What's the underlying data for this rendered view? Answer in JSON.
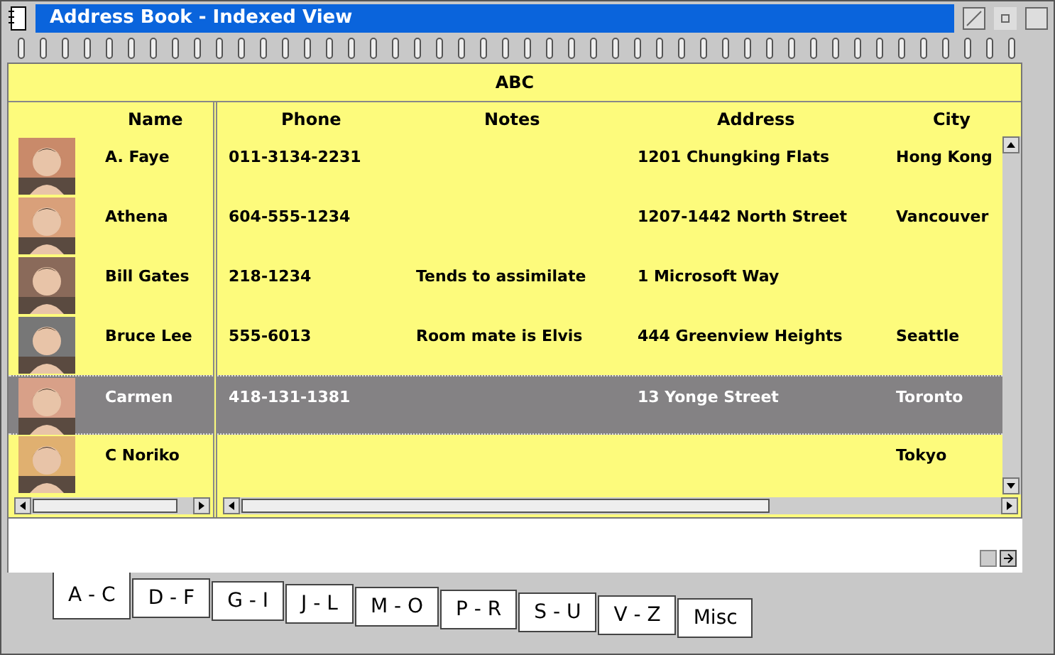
{
  "window": {
    "title": "Address Book - Indexed View"
  },
  "section_title": "ABC",
  "columns": [
    "Name",
    "Phone",
    "Notes",
    "Address",
    "City"
  ],
  "rows": [
    {
      "name": "A. Faye",
      "phone": "011-3134-2231",
      "notes": "",
      "address": "1201 Chungking Flats",
      "city": "Hong Kong",
      "selected": false
    },
    {
      "name": "Athena",
      "phone": "604-555-1234",
      "notes": "",
      "address": "1207-1442 North Street",
      "city": "Vancouver",
      "selected": false
    },
    {
      "name": "Bill Gates",
      "phone": "218-1234",
      "notes": "Tends to assimilate",
      "address": "1 Microsoft Way",
      "city": "",
      "selected": false
    },
    {
      "name": "Bruce Lee",
      "phone": "555-6013",
      "notes": "Room mate is Elvis",
      "address": "444 Greenview Heights",
      "city": "Seattle",
      "selected": false
    },
    {
      "name": "Carmen",
      "phone": "418-131-1381",
      "notes": "",
      "address": "13 Yonge Street",
      "city": "Toronto",
      "selected": true
    },
    {
      "name": "C Noriko",
      "phone": "",
      "notes": "",
      "address": "",
      "city": "Tokyo",
      "selected": false
    }
  ],
  "tabs": [
    {
      "label": "A - C",
      "selected": true
    },
    {
      "label": "D - F",
      "selected": false
    },
    {
      "label": "G - I",
      "selected": false
    },
    {
      "label": "J - L",
      "selected": false
    },
    {
      "label": "M - O",
      "selected": false
    },
    {
      "label": "P - R",
      "selected": false
    },
    {
      "label": "S - U",
      "selected": false
    },
    {
      "label": "V - Z",
      "selected": false
    },
    {
      "label": "Misc",
      "selected": false
    }
  ]
}
